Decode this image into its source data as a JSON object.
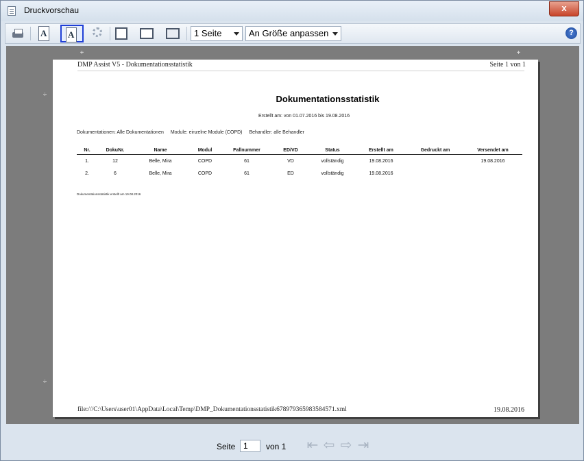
{
  "window": {
    "title": "Druckvorschau",
    "close_glyph": "x",
    "help_glyph": "?"
  },
  "toolbar": {
    "page_mode": "1 Seite",
    "zoom_mode": "An Größe anpassen",
    "icons": [
      "printer-icon",
      "portrait-icon",
      "landscape-icon",
      "settings-icon",
      "single-page-icon",
      "fit-width-icon",
      "fit-page-icon"
    ],
    "active_icon": "landscape-icon",
    "page_a_glyph": "A"
  },
  "document": {
    "header_left": "DMP Assist V5 - Dokumentationsstatistik",
    "header_right": "Seite 1 von 1",
    "title": "Dokumentationsstatistik",
    "created_range": "Erstellt am: von 01.07.2016 bis 19.08.2016",
    "filter_docs": "Dokumentationen: Alle Dokumentationen",
    "filter_modules": "Module: einzelne Module (COPD)",
    "filter_provider": "Behandler: alle Behandler",
    "columns": [
      "Nr.",
      "DokuNr.",
      "Name",
      "Modul",
      "Fallnummer",
      "ED/VD",
      "Status",
      "Erstellt am",
      "Gedruckt am",
      "Versendet am"
    ],
    "rows": [
      [
        "1.",
        "12",
        "Belle, Mira",
        "COPD",
        "61",
        "VD",
        "vollständig",
        "19.08.2016",
        "",
        "19.08.2016"
      ],
      [
        "2.",
        "6",
        "Belle, Mira",
        "COPD",
        "61",
        "ED",
        "vollständig",
        "19.08.2016",
        "",
        ""
      ]
    ],
    "footnote": "Dokumentationsstatistik erstellt am 19.08.2016",
    "file_path": "file:///C:\\Users\\user01\\AppData\\Local\\Temp\\DMP_Dokumentationsstatistik678979365983584571.xml",
    "footer_date": "19.08.2016"
  },
  "navigation": {
    "page_label": "Seite",
    "page_value": "1",
    "of_label": "von 1",
    "buttons": [
      "first-page-icon",
      "prev-page-icon",
      "next-page-icon",
      "last-page-icon"
    ]
  }
}
